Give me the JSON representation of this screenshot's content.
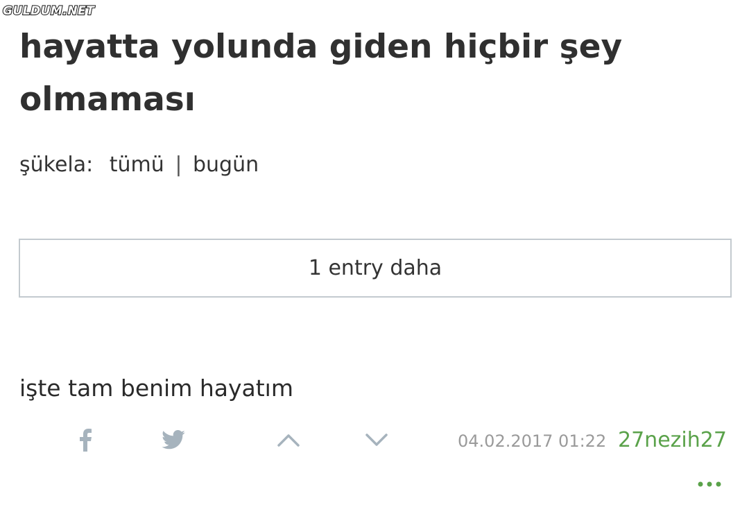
{
  "watermark": "GULDUM.NET",
  "topic": {
    "title": "hayatta yolunda giden hiçbir şey olmaması"
  },
  "filters": {
    "label": "şükela:",
    "all": "tümü",
    "separator": "|",
    "today": "bugün"
  },
  "more_entries": {
    "label": "1 entry daha"
  },
  "entry": {
    "text": "işte tam benim hayatım",
    "date": "04.02.2017 01:22",
    "author": "27nezih27"
  },
  "icons": {
    "share_facebook": "facebook-icon",
    "share_twitter": "twitter-icon",
    "upvote": "chevron-up-icon",
    "downvote": "chevron-down-icon",
    "more": "more-dots-icon"
  },
  "colors": {
    "author": "#5aa24a",
    "icon": "#a6b3bd",
    "date": "#9a9a9a",
    "box_border": "#c3cacf"
  }
}
